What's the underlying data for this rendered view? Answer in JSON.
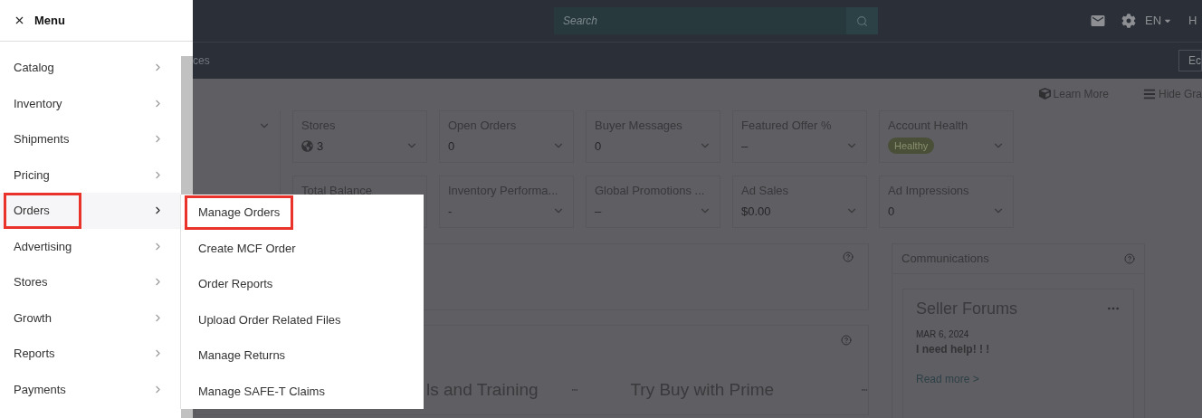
{
  "top_bar": {
    "search": {
      "placeholder": "Search"
    },
    "language": "EN",
    "cut_label": "H"
  },
  "sub_bar": {
    "cut_text": "ces",
    "button": "Ec"
  },
  "toolbar": {
    "links": [
      {
        "label": "Learn More",
        "kind": "cube"
      },
      {
        "label": "Hide Gra",
        "kind": "bars"
      }
    ]
  },
  "metrics": [
    {
      "title": "Stores",
      "value": "3",
      "kind": "globe"
    },
    {
      "title": "Open Orders",
      "value": "0",
      "kind": "plain"
    },
    {
      "title": "Buyer Messages",
      "value": "0",
      "kind": "plain"
    },
    {
      "title": "Featured Offer %",
      "value": "–",
      "kind": "plain"
    },
    {
      "title": "Account Health",
      "value": "Healthy",
      "kind": "badge"
    },
    {
      "title": "Total Balance",
      "kind": "covered"
    },
    {
      "title": "Inventory Performa...",
      "value": "-",
      "kind": "plain"
    },
    {
      "title": "Global Promotions ...",
      "value": "–",
      "kind": "plain"
    },
    {
      "title": "Ad Sales",
      "value": "$0.00",
      "kind": "plain"
    },
    {
      "title": "Ad Impressions",
      "value": "0",
      "kind": "plain"
    }
  ],
  "widgets": [
    {
      "title": "ls and Training"
    },
    {
      "title": "Try Buy with Prime"
    }
  ],
  "communications": {
    "title": "Communications",
    "forum": {
      "title": "Seller Forums",
      "date": "MAR 6, 2024",
      "post": "I need help! ! !",
      "link": "Read more >"
    }
  },
  "menu": {
    "title": "Menu",
    "items": [
      {
        "label": "Catalog",
        "selected": false,
        "highlighted": false
      },
      {
        "label": "Inventory",
        "selected": false,
        "highlighted": false
      },
      {
        "label": "Shipments",
        "selected": false,
        "highlighted": false
      },
      {
        "label": "Pricing",
        "selected": false,
        "highlighted": false
      },
      {
        "label": "Orders",
        "selected": true,
        "highlighted": true
      },
      {
        "label": "Advertising",
        "selected": false,
        "highlighted": false
      },
      {
        "label": "Stores",
        "selected": false,
        "highlighted": false
      },
      {
        "label": "Growth",
        "selected": false,
        "highlighted": false
      },
      {
        "label": "Reports",
        "selected": false,
        "highlighted": false
      },
      {
        "label": "Payments",
        "selected": false,
        "highlighted": false
      }
    ],
    "submenu": [
      {
        "label": "Manage Orders",
        "highlighted": true
      },
      {
        "label": "Create MCF Order",
        "highlighted": false
      },
      {
        "label": "Order Reports",
        "highlighted": false
      },
      {
        "label": "Upload Order Related Files",
        "highlighted": false
      },
      {
        "label": "Manage Returns",
        "highlighted": false
      },
      {
        "label": "Manage SAFE-T Claims",
        "highlighted": false
      }
    ]
  }
}
